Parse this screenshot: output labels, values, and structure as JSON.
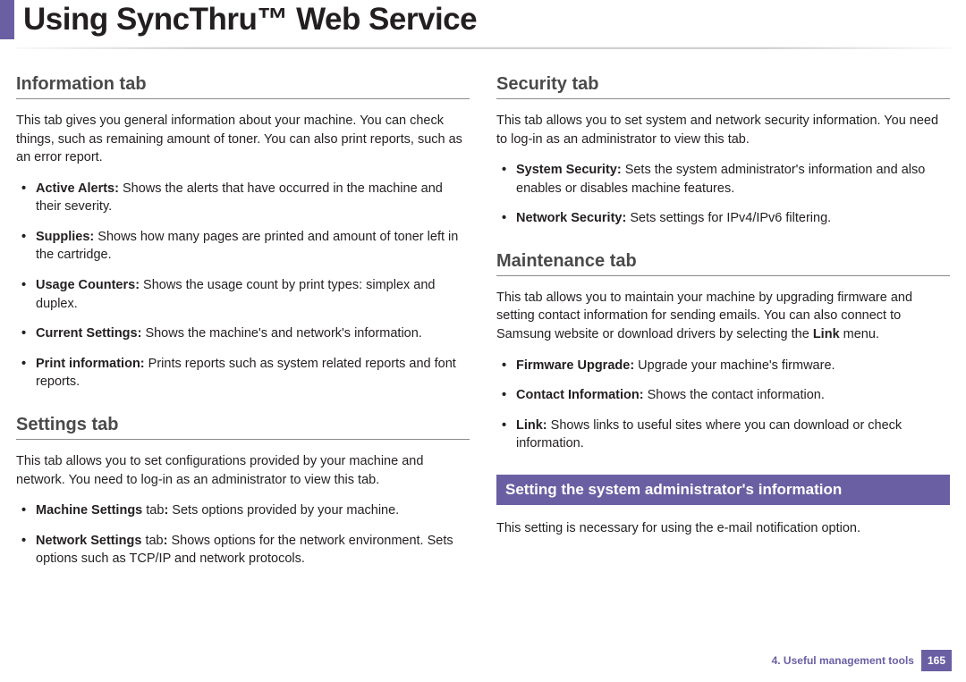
{
  "page_title": "Using SyncThru™ Web Service",
  "left": {
    "info": {
      "heading": "Information tab",
      "intro": "This tab gives you general information about your machine. You can check things, such as remaining amount of toner. You can also print reports, such as an error report.",
      "items": [
        {
          "term": "Active Alerts:",
          "desc": " Shows the alerts that have occurred in the machine and their severity."
        },
        {
          "term": "Supplies:",
          "desc": " Shows how many pages are printed and amount of toner left in the cartridge."
        },
        {
          "term": "Usage Counters:",
          "desc": " Shows the usage count by print types: simplex and duplex."
        },
        {
          "term": "Current Settings:",
          "desc": " Shows the machine's and network's information."
        },
        {
          "term": "Print information:",
          "desc": " Prints reports such as system related reports and font reports."
        }
      ]
    },
    "settings": {
      "heading": "Settings tab",
      "intro": "This tab allows you to set configurations provided by your machine and network. You need to log-in as an administrator to view this tab.",
      "items": [
        {
          "term": "Machine Settings",
          "suffix": " tab",
          "desc": " Sets options provided by your machine."
        },
        {
          "term": "Network Settings",
          "suffix": " tab",
          "desc": " Shows options for the network environment. Sets options such as TCP/IP and network protocols."
        }
      ]
    }
  },
  "right": {
    "security": {
      "heading": "Security tab",
      "intro": "This tab allows you to set system and network security information. You need to log-in as an administrator to view this tab.",
      "items": [
        {
          "term": "System Security:",
          "desc": " Sets the system administrator's information and also enables or disables machine features."
        },
        {
          "term": "Network Security:",
          "desc": " Sets settings for IPv4/IPv6 filtering."
        }
      ]
    },
    "maintenance": {
      "heading": "Maintenance tab",
      "intro_pre": "This tab allows you to maintain your machine by upgrading firmware and setting contact information for sending emails. You can also connect to Samsung website or download drivers by selecting the ",
      "intro_link": "Link",
      "intro_post": " menu.",
      "items": [
        {
          "term": "Firmware Upgrade:",
          "desc": " Upgrade your machine's firmware."
        },
        {
          "term": "Contact Information:",
          "desc": " Shows the contact information."
        },
        {
          "term": "Link:",
          "desc": " Shows links to useful sites where you can download or check information."
        }
      ]
    },
    "admin": {
      "bar": "Setting the system administrator's information",
      "text": "This setting is necessary for using the e-mail notification option."
    }
  },
  "footer": {
    "chapter": "4.  Useful management tools",
    "page": "165"
  }
}
